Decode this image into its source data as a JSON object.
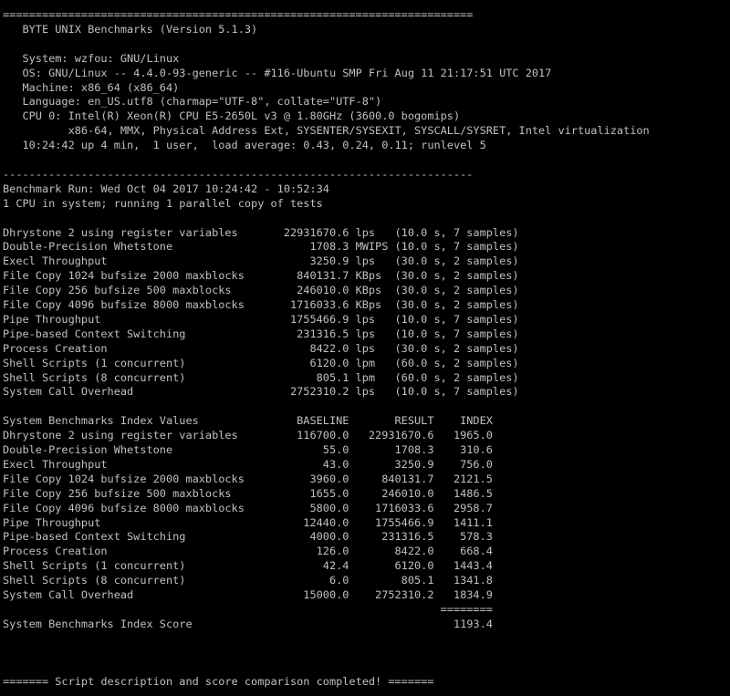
{
  "terminal": {
    "background": "#000000",
    "foreground": "#c0c0c0",
    "lines": [
      "========================================================================",
      "   BYTE UNIX Benchmarks (Version 5.1.3)",
      "",
      "   System: wzfou: GNU/Linux",
      "   OS: GNU/Linux -- 4.4.0-93-generic -- #116-Ubuntu SMP Fri Aug 11 21:17:51 UTC 2017",
      "   Machine: x86_64 (x86_64)",
      "   Language: en_US.utf8 (charmap=\"UTF-8\", collate=\"UTF-8\")",
      "   CPU 0: Intel(R) Xeon(R) CPU E5-2650L v3 @ 1.80GHz (3600.0 bogomips)",
      "          x86-64, MMX, Physical Address Ext, SYSENTER/SYSEXIT, SYSCALL/SYSRET, Intel virtualization",
      "   10:24:42 up 4 min,  1 user,  load average: 0.43, 0.24, 0.11; runlevel 5",
      "",
      "------------------------------------------------------------------------",
      "Benchmark Run: Wed Oct 04 2017 10:24:42 - 10:52:34",
      "1 CPU in system; running 1 parallel copy of tests",
      "",
      "Dhrystone 2 using register variables       22931670.6 lps   (10.0 s, 7 samples)",
      "Double-Precision Whetstone                     1708.3 MWIPS (10.0 s, 7 samples)",
      "Execl Throughput                               3250.9 lps   (30.0 s, 2 samples)",
      "File Copy 1024 bufsize 2000 maxblocks        840131.7 KBps  (30.0 s, 2 samples)",
      "File Copy 256 bufsize 500 maxblocks          246010.0 KBps  (30.0 s, 2 samples)",
      "File Copy 4096 bufsize 8000 maxblocks       1716033.6 KBps  (30.0 s, 2 samples)",
      "Pipe Throughput                             1755466.9 lps   (10.0 s, 7 samples)",
      "Pipe-based Context Switching                 231316.5 lps   (10.0 s, 7 samples)",
      "Process Creation                               8422.0 lps   (30.0 s, 2 samples)",
      "Shell Scripts (1 concurrent)                   6120.0 lpm   (60.0 s, 2 samples)",
      "Shell Scripts (8 concurrent)                    805.1 lpm   (60.0 s, 2 samples)",
      "System Call Overhead                        2752310.2 lps   (10.0 s, 7 samples)",
      "",
      "System Benchmarks Index Values               BASELINE       RESULT    INDEX",
      "Dhrystone 2 using register variables         116700.0   22931670.6   1965.0",
      "Double-Precision Whetstone                       55.0       1708.3    310.6",
      "Execl Throughput                                 43.0       3250.9    756.0",
      "File Copy 1024 bufsize 2000 maxblocks          3960.0     840131.7   2121.5",
      "File Copy 256 bufsize 500 maxblocks            1655.0     246010.0   1486.5",
      "File Copy 4096 bufsize 8000 maxblocks          5800.0    1716033.6   2958.7",
      "Pipe Throughput                               12440.0    1755466.9   1411.1",
      "Pipe-based Context Switching                   4000.0     231316.5    578.3",
      "Process Creation                                126.0       8422.0    668.4",
      "Shell Scripts (1 concurrent)                     42.4       6120.0   1443.4",
      "Shell Scripts (8 concurrent)                      6.0        805.1   1341.8",
      "System Call Overhead                          15000.0    2752310.2   1834.9",
      "                                                                   ========",
      "System Benchmarks Index Score                                        1193.4",
      "",
      "",
      "",
      "======= Script description and score comparison completed! ======="
    ]
  }
}
